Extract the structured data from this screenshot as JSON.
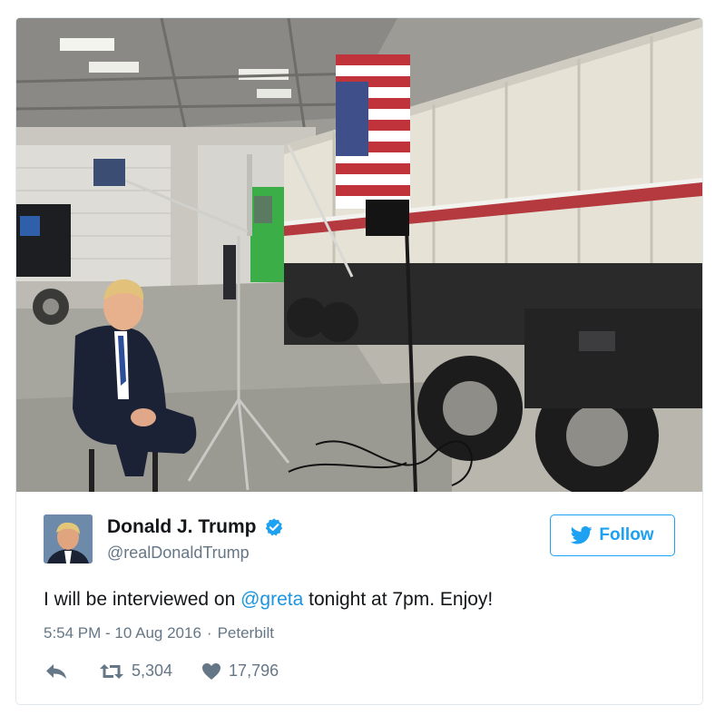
{
  "tweet": {
    "author": {
      "name": "Donald J. Trump",
      "handle": "@realDonaldTrump",
      "verified": true
    },
    "follow_label": "Follow",
    "text_before": "I will be interviewed on ",
    "mention": "@greta",
    "text_after": " tonight at 7pm. Enjoy!",
    "time": "5:54 PM - 10 Aug 2016",
    "separator": "·",
    "source": "Peterbilt",
    "retweet_count": "5,304",
    "like_count": "17,796"
  },
  "icons": {
    "verified": "verified-badge-icon",
    "follow": "bird-icon",
    "reply": "reply-icon",
    "retweet": "retweet-icon",
    "like": "heart-icon"
  },
  "colors": {
    "accent": "#1da1f2",
    "link": "#1b95e0",
    "text": "#14171a",
    "muted": "#657786",
    "border": "#e1e8ed"
  }
}
